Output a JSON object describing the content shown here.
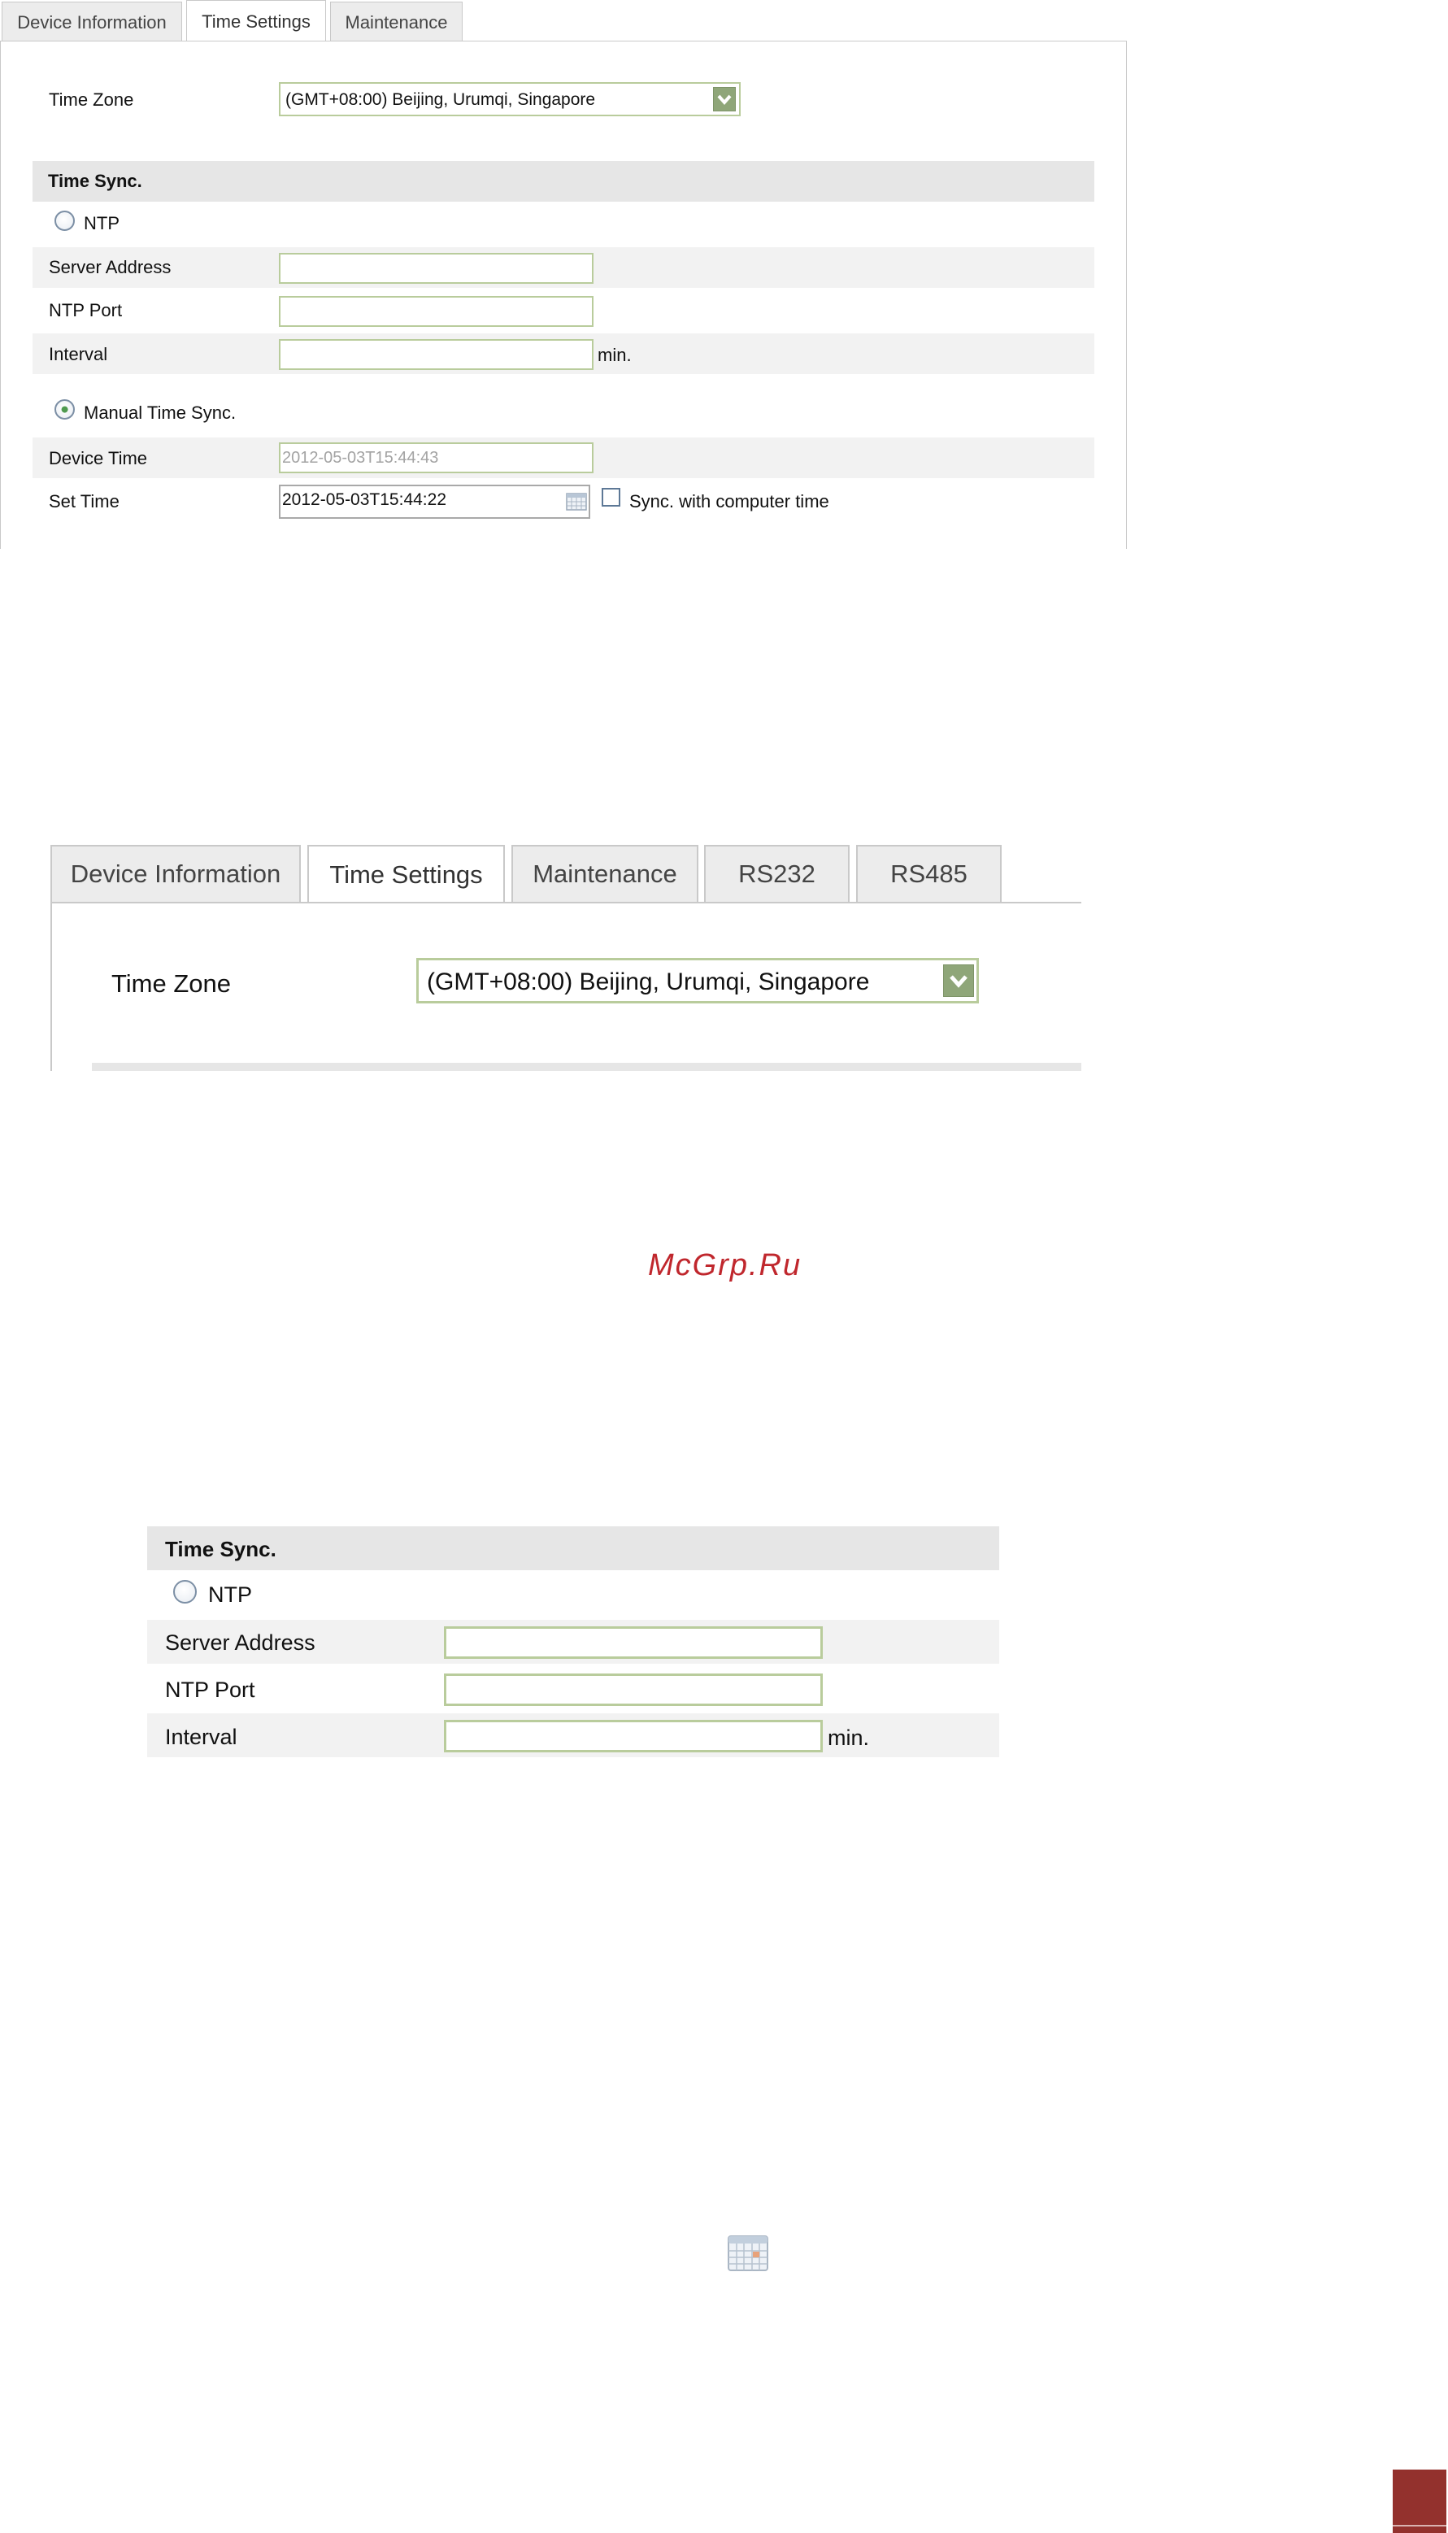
{
  "shot1": {
    "tabs": [
      "Device Information",
      "Time Settings",
      "Maintenance"
    ],
    "active_tab": "Time Settings",
    "time_zone_label": "Time Zone",
    "time_zone_value": "(GMT+08:00) Beijing, Urumqi, Singapore",
    "time_sync_header": "Time Sync.",
    "ntp_label": "NTP",
    "server_address_label": "Server Address",
    "server_address_value": "",
    "ntp_port_label": "NTP Port",
    "ntp_port_value": "",
    "interval_label": "Interval",
    "interval_value": "",
    "interval_unit": "min.",
    "manual_label": "Manual Time Sync.",
    "device_time_label": "Device Time",
    "device_time_value": "2012-05-03T15:44:43",
    "set_time_label": "Set Time",
    "set_time_value": "2012-05-03T15:44:22",
    "sync_label": "Sync. with computer time",
    "selected_mode": "Manual Time Sync."
  },
  "shot2": {
    "tabs": [
      "Device Information",
      "Time Settings",
      "Maintenance",
      "RS232",
      "RS485"
    ],
    "active_tab": "Time Settings",
    "time_zone_label": "Time Zone",
    "time_zone_value": "(GMT+08:00) Beijing, Urumqi, Singapore"
  },
  "watermark": "McGrp.Ru",
  "shot3": {
    "time_sync_header": "Time Sync.",
    "ntp_label": "NTP",
    "server_address_label": "Server Address",
    "ntp_port_label": "NTP Port",
    "interval_label": "Interval",
    "interval_unit": "min."
  },
  "calendar_icon": "calendar-icon",
  "colors": {
    "field_border": "#b9cc9c",
    "dropdown_button": "#8fa679",
    "watermark": "#c0272d",
    "corner_box": "#93312d"
  }
}
